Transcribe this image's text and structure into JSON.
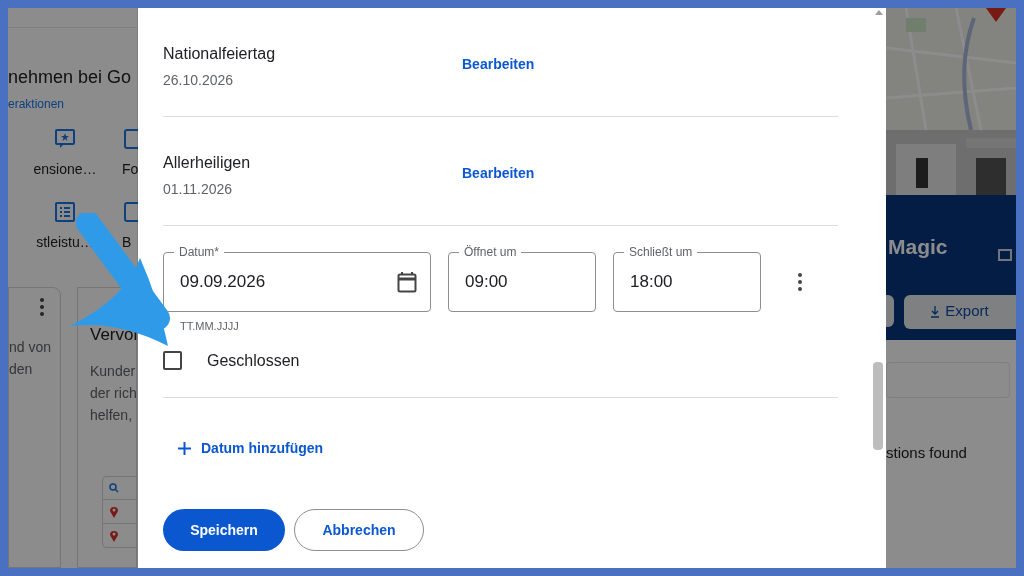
{
  "background": {
    "heading": "nehmen bei Go",
    "link": "eraktionen",
    "shortcuts": [
      {
        "label": "ensione…",
        "kind": "review"
      },
      {
        "label": "Fo"
      },
      {
        "label": "stleistu…",
        "kind": "list"
      },
      {
        "label": "B"
      }
    ],
    "cards": [
      {
        "lines": [
          "nd von",
          "den"
        ]
      },
      {
        "title": "Vervol",
        "lines": [
          "Kunder",
          "der rich",
          "helfen,"
        ]
      }
    ],
    "panel_title": "Magic",
    "export_button": "Export",
    "status": "stions found"
  },
  "holidays": [
    {
      "name": "Nationalfeiertag",
      "date": "26.10.2026",
      "action": "Bearbeiten"
    },
    {
      "name": "Allerheiligen",
      "date": "01.11.2026",
      "action": "Bearbeiten"
    }
  ],
  "new_entry": {
    "date_field": {
      "label": "Datum*",
      "value": "09.09.2026",
      "hint": "TT.MM.JJJJ"
    },
    "open_field": {
      "label": "Öffnet um",
      "value": "09:00"
    },
    "close_field": {
      "label": "Schließt um",
      "value": "18:00"
    },
    "closed": {
      "label": "Geschlossen",
      "checked": false
    }
  },
  "add_date": "Datum hinzufügen",
  "buttons": [
    {
      "label": "Speichern",
      "kind": "primary"
    },
    {
      "label": "Abbrechen",
      "kind": "secondary"
    }
  ]
}
